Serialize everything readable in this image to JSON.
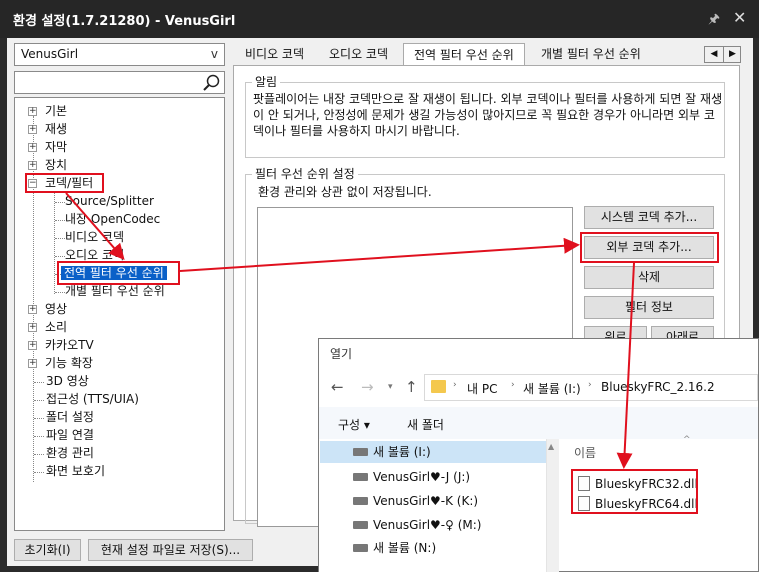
{
  "window": {
    "title": "환경 설정(1.7.21280) - VenusGirl",
    "pin_glyph": "🖈",
    "close_glyph": "✕"
  },
  "left": {
    "profile": "VenusGirl",
    "profile_arrow": "v",
    "tree": {
      "basic": "기본",
      "playback": "재생",
      "subtitle": "자막",
      "device": "장치",
      "codec_filter": "코덱/필터",
      "source_splitter": "Source/Splitter",
      "internal_opencodec": "내장 OpenCodec",
      "video_codec": "비디오 코덱",
      "audio_codec": "오디오 코덱",
      "global_filter_priority": "전역 필터 우선 순위",
      "individual_filter_priority": "개별 필터 우선 순위",
      "video": "영상",
      "sound": "소리",
      "kakaotv": "카카오TV",
      "extensions": "기능 확장",
      "video_3d": "3D 영상",
      "accessibility": "접근성 (TTS/UIA)",
      "folder_settings": "폴더 설정",
      "file_association": "파일 연결",
      "preferences_management": "환경 관리",
      "screensaver": "화면 보호기"
    },
    "reset_button": "초기화(I)",
    "save_to_file_button": "현재 설정 파일로 저장(S)..."
  },
  "tabs": {
    "video_codec": "비디오 코덱",
    "audio_codec": "오디오 코덱",
    "global_filter": "전역 필터 우선 순위",
    "individual_filter": "개별 필터 우선 순위",
    "scroll_left": "◀",
    "scroll_right": "▶"
  },
  "notice": {
    "title": "알림",
    "text": "팟플레이어는 내장 코덱만으로 잘 재생이 됩니다. 외부 코덱이나 필터를 사용하게 되면 잘 재생이 안 되거나, 안정성에 문제가 생길 가능성이 많아지므로 꼭 필요한 경우가 아니라면 외부 코덱이나 필터를 사용하지 마시기 바랍니다."
  },
  "priority": {
    "title": "필터 우선 순위 설정",
    "subtitle": "환경 관리와 상관 없이 저장됩니다.",
    "add_system_codec": "시스템 코덱 추가...",
    "add_external_codec": "외부 코덱 추가...",
    "delete": "삭제",
    "filter_info": "필터 정보",
    "up": "위로",
    "down": "아래로"
  },
  "dialog": {
    "title": "열기",
    "breadcrumb": [
      "내 PC",
      "새 볼륨 (I:)",
      "BlueskyFRC_2.16.2"
    ],
    "organize": "구성 ▾",
    "new_folder": "새 폴더",
    "name_column": "이름",
    "drives": [
      "새 볼륨 (I:)",
      "VenusGirl♥-J (J:)",
      "VenusGirl♥-K (K:)",
      "VenusGirl♥-♀ (M:)",
      "새 볼륨 (N:)"
    ],
    "files": [
      "BlueskyFRC32.dll",
      "BlueskyFRC64.dll"
    ]
  },
  "colors": {
    "highlight": "#e0101e",
    "selection": "#0a60c8"
  }
}
